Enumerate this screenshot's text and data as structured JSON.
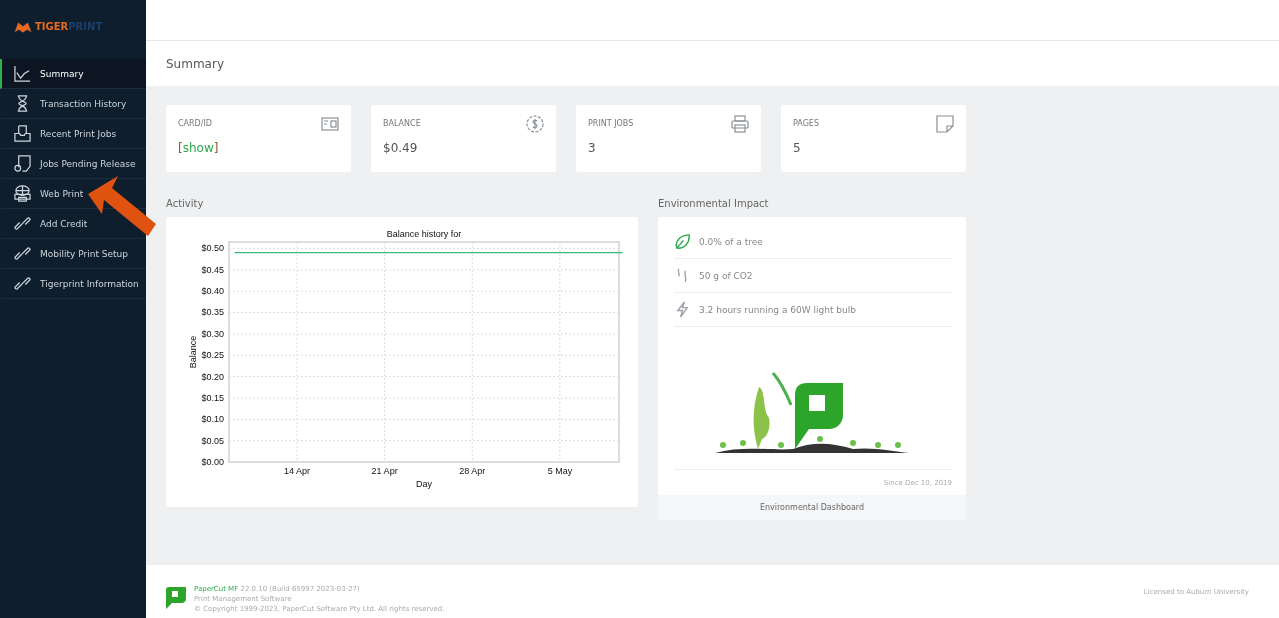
{
  "logo": {
    "part_1": "TIGER",
    "part_2": "PRINT"
  },
  "sidebar": {
    "items": [
      {
        "label": "Summary",
        "selected": true
      },
      {
        "label": "Transaction History",
        "selected": false
      },
      {
        "label": "Recent Print Jobs",
        "selected": false
      },
      {
        "label": "Jobs Pending Release",
        "selected": false
      },
      {
        "label": "Web Print",
        "selected": false
      },
      {
        "label": "Add Credit",
        "selected": false
      },
      {
        "label": "Mobility Print Setup",
        "selected": false
      },
      {
        "label": "Tigerprint Information",
        "selected": false
      }
    ]
  },
  "page_title": "Summary",
  "cards": [
    {
      "label": "CARD/ID",
      "kind": "link",
      "bracket_open": "[",
      "value": "show",
      "bracket_close": "]"
    },
    {
      "label": "BALANCE",
      "kind": "text",
      "value": "$0.49"
    },
    {
      "label": "PRINT JOBS",
      "kind": "text",
      "value": "3"
    },
    {
      "label": "PAGES",
      "kind": "text",
      "value": "5"
    }
  ],
  "activity": {
    "heading": "Activity",
    "chart_data": {
      "type": "line",
      "title": "Balance history for",
      "xlabel": "Day",
      "ylabel": "Balance",
      "categories": [
        null,
        null,
        null,
        null,
        null,
        "14 Apr",
        null,
        null,
        null,
        null,
        null,
        null,
        "21 Apr",
        null,
        null,
        null,
        null,
        null,
        null,
        "28 Apr",
        null,
        null,
        null,
        null,
        null,
        null,
        "5 May",
        null,
        null,
        null,
        null,
        null
      ],
      "series": [
        {
          "color": "#3cb878",
          "values": [
            0.49,
            0.49,
            0.49,
            0.49,
            0.49,
            0.49,
            0.49,
            0.49,
            0.49,
            0.49,
            0.49,
            0.49,
            0.49,
            0.49,
            0.49,
            0.49,
            0.49,
            0.49,
            0.49,
            0.49,
            0.49,
            0.49,
            0.49,
            0.49,
            0.49,
            0.49,
            0.49,
            0.49,
            0.49,
            0.49,
            0.49,
            0.49
          ]
        }
      ],
      "ylim": [
        0,
        0.515
      ],
      "grid": true,
      "yticks": [
        {
          "value": 0,
          "label": "$0.00"
        },
        {
          "value": 0.05,
          "label": "$0.05"
        },
        {
          "value": 0.1,
          "label": "$0.10"
        },
        {
          "value": 0.15,
          "label": "$0.15"
        },
        {
          "value": 0.2,
          "label": "$0.20"
        },
        {
          "value": 0.25,
          "label": "$0.25"
        },
        {
          "value": 0.3,
          "label": "$0.30"
        },
        {
          "value": 0.35,
          "label": "$0.35"
        },
        {
          "value": 0.4,
          "label": "$0.40"
        },
        {
          "value": 0.45,
          "label": "$0.45"
        },
        {
          "value": 0.5,
          "label": "$0.50"
        }
      ]
    }
  },
  "environment": {
    "heading": "Environmental Impact",
    "items": [
      {
        "text": "0.0% of a tree"
      },
      {
        "text": "50 g of CO2"
      },
      {
        "text": "3.2 hours running a 60W light bulb"
      }
    ],
    "since": "Since Dec 10, 2019",
    "link": "Environmental Dashboard"
  },
  "footer": {
    "product": "PaperCut MF",
    "version": "22.0.10 (Build 65997 2023-03-27)",
    "subtitle": "Print Management Software",
    "copyright": "© Copyright 1999-2023, PaperCut Software Pty Ltd. All rights reserved.",
    "license": "Licensed to Auburn University"
  }
}
